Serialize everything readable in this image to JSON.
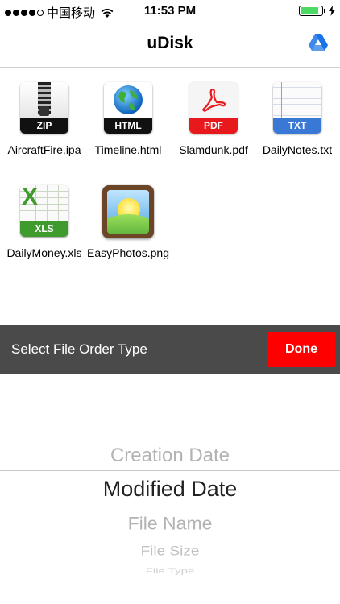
{
  "status_bar": {
    "carrier": "中国移动",
    "time": "11:53 PM",
    "battery_level": 0.85,
    "battery_color": "#4cd964"
  },
  "nav": {
    "title": "uDisk",
    "action_icon": "google-drive-icon"
  },
  "files": [
    {
      "name": "AircraftFire.ipa",
      "type": "ZIP",
      "icon": "zip-archive-icon"
    },
    {
      "name": "Timeline.html",
      "type": "HTML",
      "icon": "html-globe-icon"
    },
    {
      "name": "Slamdunk.pdf",
      "type": "PDF",
      "icon": "pdf-document-icon",
      "band_color": "#e8191d"
    },
    {
      "name": "DailyNotes.txt",
      "type": "TXT",
      "icon": "txt-document-icon",
      "band_color": "#3a78d6"
    },
    {
      "name": "DailyMoney.xls",
      "type": "XLS",
      "icon": "xls-spreadsheet-icon",
      "band_color": "#3f9b2e"
    },
    {
      "name": "EasyPhotos.png",
      "type": "",
      "icon": "photo-image-icon"
    }
  ],
  "toolbar": {
    "label": "Select File Order Type",
    "done_label": "Done",
    "done_color": "#ff0000"
  },
  "picker": {
    "options": [
      "Creation Date",
      "Modified Date",
      "File Name",
      "File Size",
      "File Type"
    ],
    "selected": "Modified Date"
  }
}
